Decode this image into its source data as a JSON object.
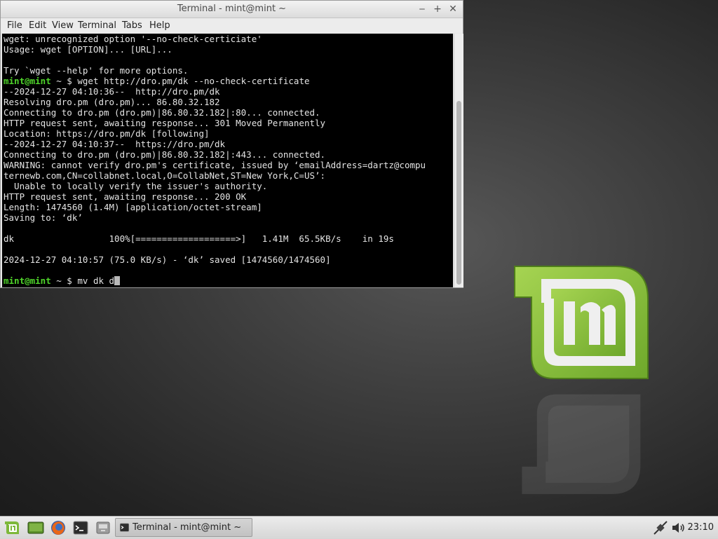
{
  "window": {
    "title": "Terminal - mint@mint ~",
    "minimize": "‒",
    "maximize": "+",
    "close": "✕"
  },
  "menu": [
    "File",
    "Edit",
    "View",
    "Terminal",
    "Tabs",
    "Help"
  ],
  "terminal": {
    "lines": [
      {
        "text": "wget: unrecognized option '--no-check-certiciate'"
      },
      {
        "text": "Usage: wget [OPTION]... [URL]..."
      },
      {
        "text": ""
      },
      {
        "text": "Try `wget --help' for more options."
      },
      {
        "prompt": "mint@mint",
        "rest": " ~ $ wget http://dro.pm/dk --no-check-certificate"
      },
      {
        "text": "--2024-12-27 04:10:36--  http://dro.pm/dk"
      },
      {
        "text": "Resolving dro.pm (dro.pm)... 86.80.32.182"
      },
      {
        "text": "Connecting to dro.pm (dro.pm)|86.80.32.182|:80... connected."
      },
      {
        "text": "HTTP request sent, awaiting response... 301 Moved Permanently"
      },
      {
        "text": "Location: https://dro.pm/dk [following]"
      },
      {
        "text": "--2024-12-27 04:10:37--  https://dro.pm/dk"
      },
      {
        "text": "Connecting to dro.pm (dro.pm)|86.80.32.182|:443... connected."
      },
      {
        "text": "WARNING: cannot verify dro.pm's certificate, issued by ‘emailAddress=dartz@compu"
      },
      {
        "text": "ternewb.com,CN=collabnet.local,O=CollabNet,ST=New York,C=US’:"
      },
      {
        "text": "  Unable to locally verify the issuer's authority."
      },
      {
        "text": "HTTP request sent, awaiting response... 200 OK"
      },
      {
        "text": "Length: 1474560 (1.4M) [application/octet-stream]"
      },
      {
        "text": "Saving to: ‘dk’"
      },
      {
        "text": ""
      },
      {
        "text": "dk                  100%[===================>]   1.41M  65.5KB/s    in 19s"
      },
      {
        "text": ""
      },
      {
        "text": "2024-12-27 04:10:57 (75.0 KB/s) - ‘dk’ saved [1474560/1474560]"
      },
      {
        "text": ""
      },
      {
        "prompt": "mint@mint",
        "rest": " ~ $ mv dk d",
        "cursor": true
      }
    ]
  },
  "taskbar": {
    "task_label": "Terminal - mint@mint ~",
    "clock": "23:10"
  },
  "icons": {
    "menu": "mint-menu-icon",
    "show_desktop": "show-desktop-icon",
    "browser": "firefox-icon",
    "terminal_launcher": "terminal-icon",
    "files": "file-manager-icon",
    "task": "terminal-icon",
    "network": "network-icon",
    "volume": "volume-icon"
  },
  "colors": {
    "prompt": "#4fd42a",
    "terminal_bg": "#000000",
    "mint_green": "#8bc34a"
  }
}
